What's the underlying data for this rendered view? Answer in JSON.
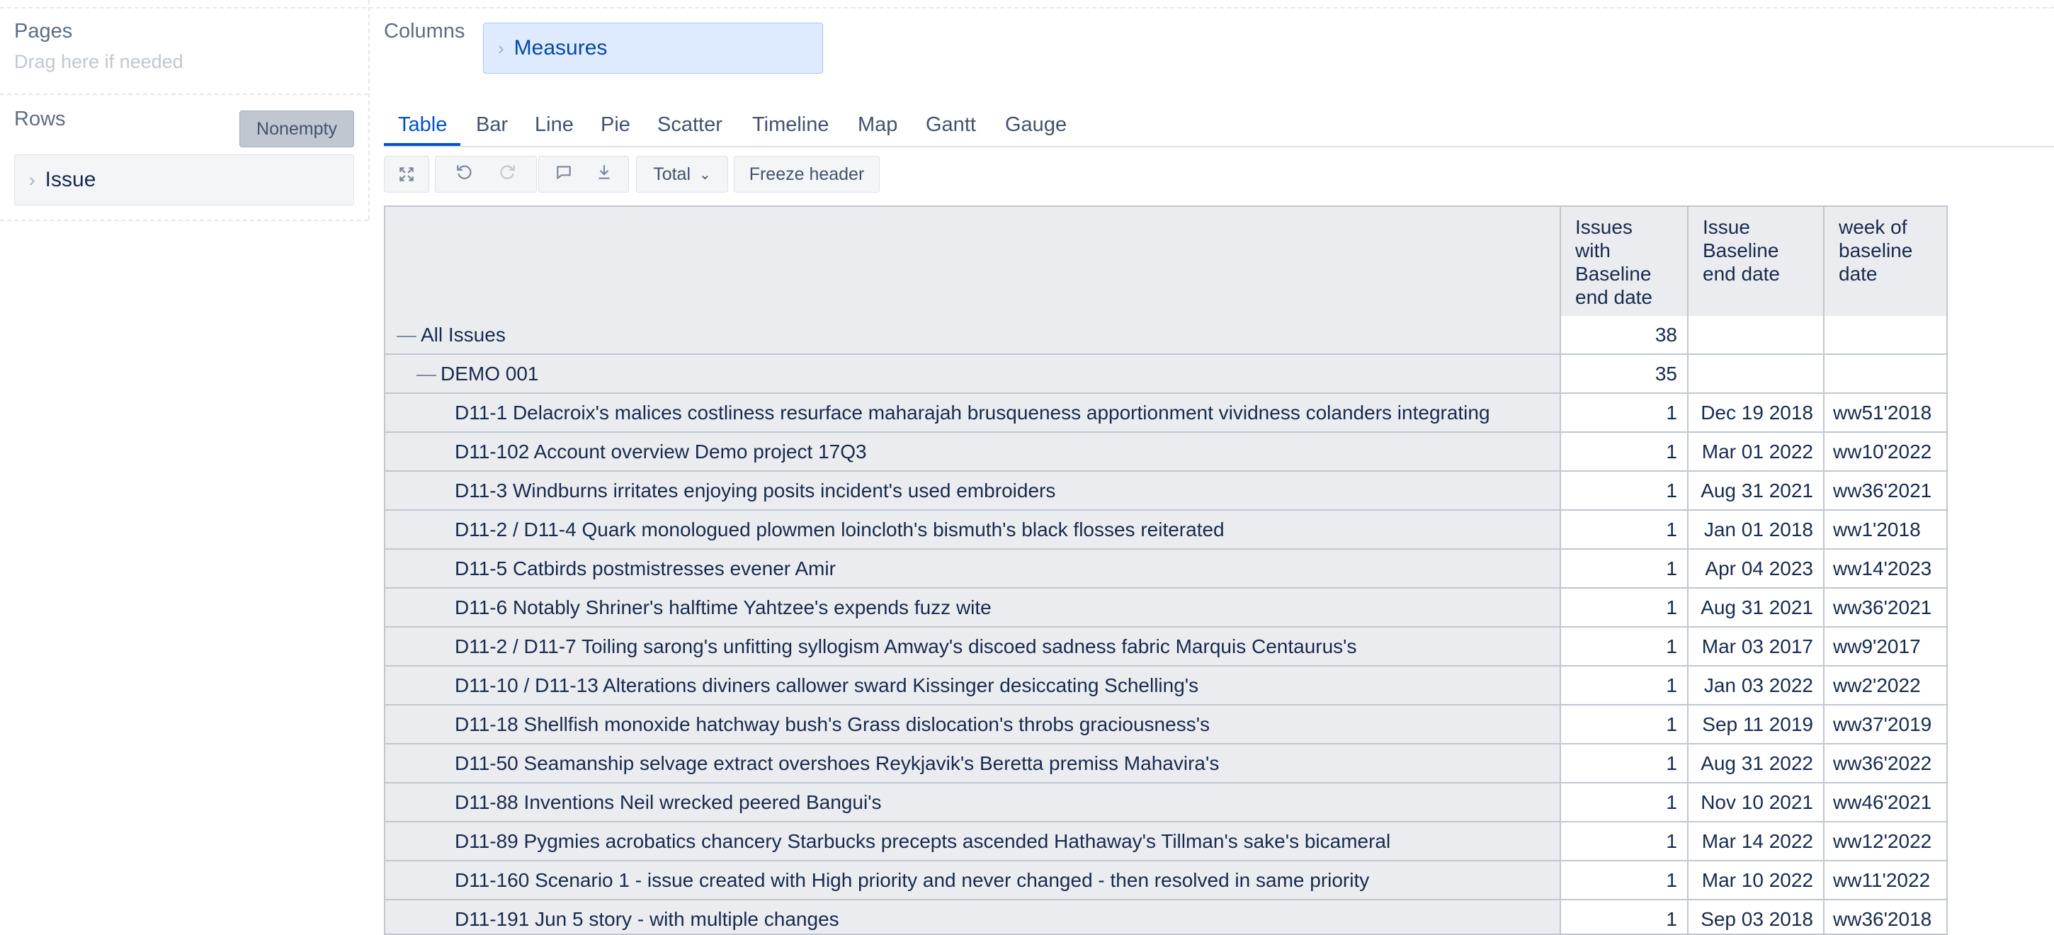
{
  "pages": {
    "title": "Pages",
    "hint": "Drag here if needed"
  },
  "rows": {
    "title": "Rows",
    "nonempty_label": "Nonempty",
    "dimension": "Issue"
  },
  "columns": {
    "title": "Columns",
    "dimension": "Measures"
  },
  "tabs": [
    {
      "label": "Table",
      "active": true
    },
    {
      "label": "Bar",
      "active": false
    },
    {
      "label": "Line",
      "active": false
    },
    {
      "label": "Pie",
      "active": false
    },
    {
      "label": "Scatter",
      "active": false
    },
    {
      "label": "Timeline",
      "active": false
    },
    {
      "label": "Map",
      "active": false
    },
    {
      "label": "Gantt",
      "active": false
    },
    {
      "label": "Gauge",
      "active": false
    }
  ],
  "toolbar": {
    "total_label": "Total",
    "freeze_label": "Freeze header"
  },
  "table": {
    "headers": [
      "Issues with Baseline end date",
      "Issue Baseline end date",
      "week of baseline date"
    ],
    "rows": [
      {
        "label": "All Issues",
        "level": 0,
        "expand": "—",
        "count": "38",
        "date": "",
        "week": ""
      },
      {
        "label": "DEMO 001",
        "level": 1,
        "expand": "—",
        "count": "35",
        "date": "",
        "week": ""
      },
      {
        "label": "D11-1 Delacroix's malices costliness resurface maharajah brusqueness apportionment vividness colanders integrating",
        "level": 2,
        "expand": "",
        "count": "1",
        "date": "Dec 19 2018",
        "week": "ww51'2018"
      },
      {
        "label": "D11-102 Account overview Demo project 17Q3",
        "level": 2,
        "expand": "",
        "count": "1",
        "date": "Mar 01 2022",
        "week": "ww10'2022"
      },
      {
        "label": "D11-3 Windburns irritates enjoying posits incident's used embroiders",
        "level": 2,
        "expand": "",
        "count": "1",
        "date": "Aug 31 2021",
        "week": "ww36'2021"
      },
      {
        "label": "D11-2 / D11-4 Quark monologued plowmen loincloth's bismuth's black flosses reiterated",
        "level": 2,
        "expand": "",
        "count": "1",
        "date": "Jan 01 2018",
        "week": "ww1'2018"
      },
      {
        "label": "D11-5 Catbirds postmistresses evener Amir",
        "level": 2,
        "expand": "",
        "count": "1",
        "date": "Apr 04 2023",
        "week": "ww14'2023"
      },
      {
        "label": "D11-6 Notably Shriner's halftime Yahtzee's expends fuzz wite",
        "level": 2,
        "expand": "",
        "count": "1",
        "date": "Aug 31 2021",
        "week": "ww36'2021"
      },
      {
        "label": "D11-2 / D11-7 Toiling sarong's unfitting syllogism Amway's discoed sadness fabric Marquis Centaurus's",
        "level": 2,
        "expand": "",
        "count": "1",
        "date": "Mar 03 2017",
        "week": "ww9'2017"
      },
      {
        "label": "D11-10 / D11-13 Alterations diviners callower sward Kissinger desiccating Schelling's",
        "level": 2,
        "expand": "",
        "count": "1",
        "date": "Jan 03 2022",
        "week": "ww2'2022"
      },
      {
        "label": "D11-18 Shellfish monoxide hatchway bush's Grass dislocation's throbs graciousness's",
        "level": 2,
        "expand": "",
        "count": "1",
        "date": "Sep 11 2019",
        "week": "ww37'2019"
      },
      {
        "label": "D11-50 Seamanship selvage extract overshoes Reykjavik's Beretta premiss Mahavira's",
        "level": 2,
        "expand": "",
        "count": "1",
        "date": "Aug 31 2022",
        "week": "ww36'2022"
      },
      {
        "label": "D11-88 Inventions Neil wrecked peered Bangui's",
        "level": 2,
        "expand": "",
        "count": "1",
        "date": "Nov 10 2021",
        "week": "ww46'2021"
      },
      {
        "label": "D11-89 Pygmies acrobatics chancery Starbucks precepts ascended Hathaway's Tillman's sake's bicameral",
        "level": 2,
        "expand": "",
        "count": "1",
        "date": "Mar 14 2022",
        "week": "ww12'2022"
      },
      {
        "label": "D11-160 Scenario 1 - issue created with High priority and never changed - then resolved in same priority",
        "level": 2,
        "expand": "",
        "count": "1",
        "date": "Mar 10 2022",
        "week": "ww11'2022"
      },
      {
        "label": "D11-191 Jun 5 story - with multiple changes",
        "level": 2,
        "expand": "",
        "count": "1",
        "date": "Sep 03 2018",
        "week": "ww36'2018"
      }
    ]
  }
}
